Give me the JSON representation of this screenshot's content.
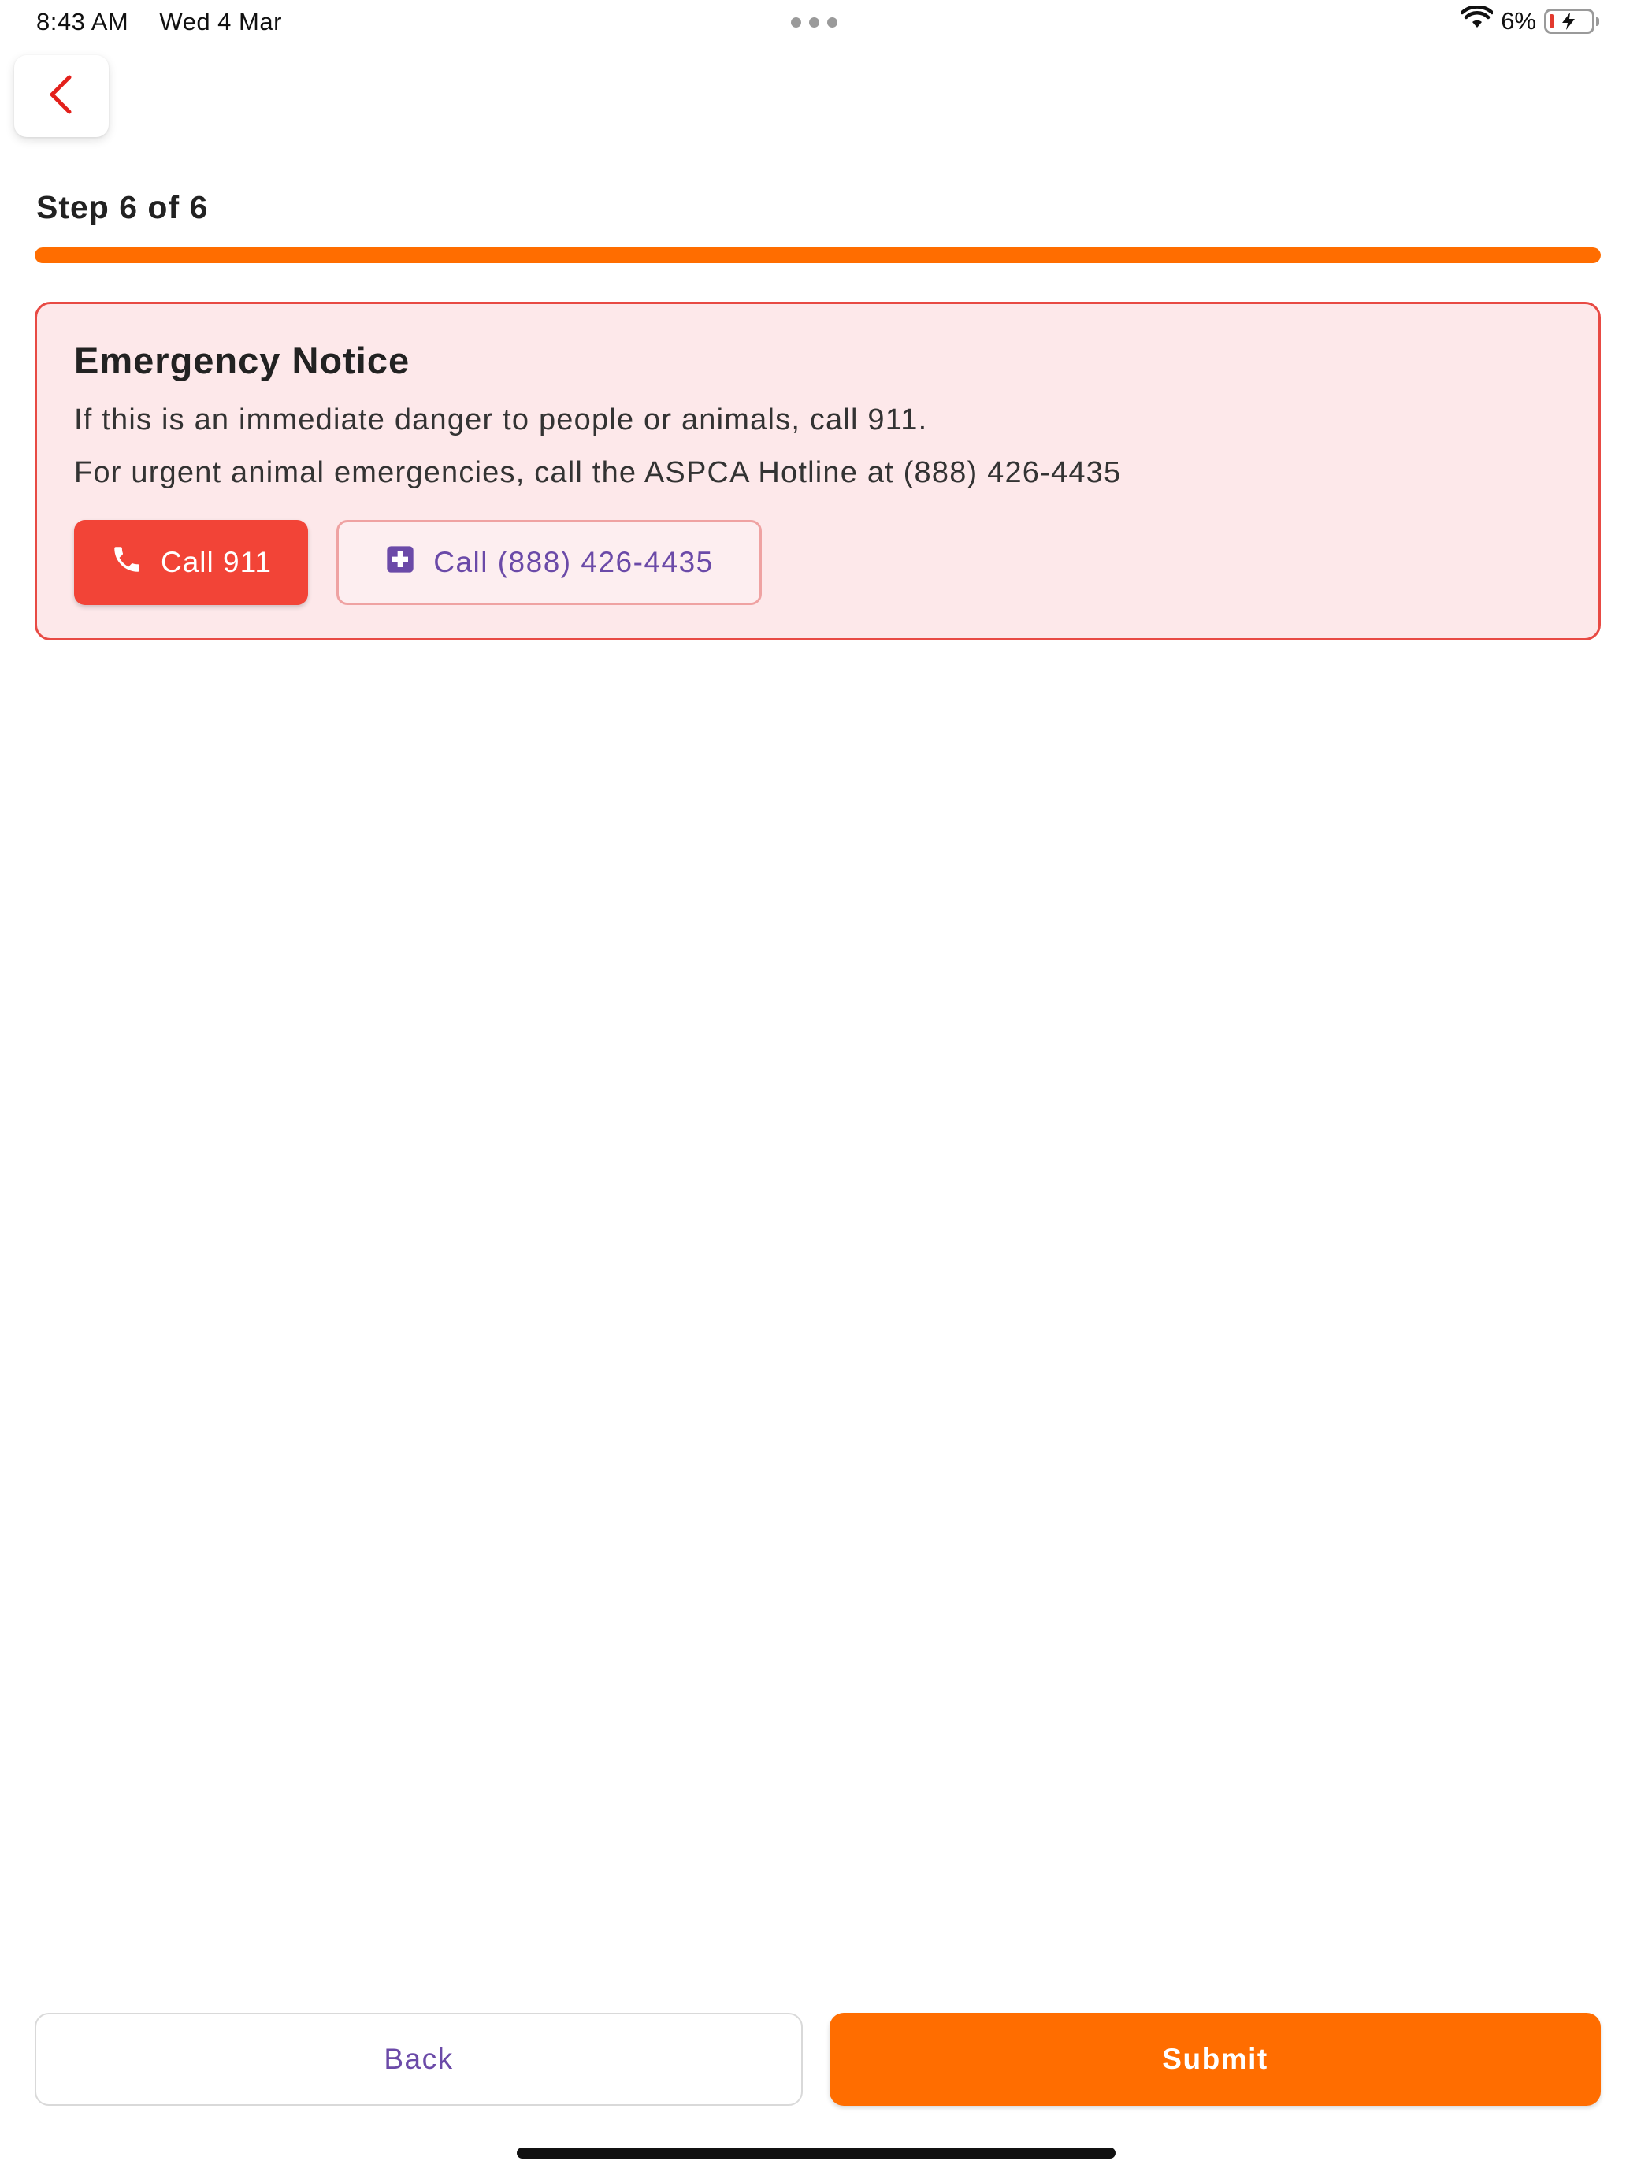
{
  "status_bar": {
    "time": "8:43 AM",
    "date": "Wed 4 Mar",
    "battery_percent": "6%"
  },
  "header": {
    "back_icon": "chevron-left-icon"
  },
  "step": {
    "label": "Step 6 of 6",
    "current": 6,
    "total": 6,
    "progress_fraction": 1.0
  },
  "emergency": {
    "title": "Emergency Notice",
    "line1": "If this is an immediate danger to people or animals, call 911.",
    "line2": "For urgent animal emergencies, call the ASPCA Hotline at (888) 426-4435",
    "call_911_label": "Call 911",
    "call_911_icon": "phone-icon",
    "call_aspca_label": "Call (888) 426-4435",
    "call_aspca_icon": "medical-cross-icon"
  },
  "footer": {
    "back_label": "Back",
    "submit_label": "Submit"
  },
  "colors": {
    "accent": "#ff6d00",
    "danger": "#f24437",
    "danger_border": "#e84a44",
    "danger_bg": "#fde8ea",
    "purple": "#6b4aa8"
  }
}
